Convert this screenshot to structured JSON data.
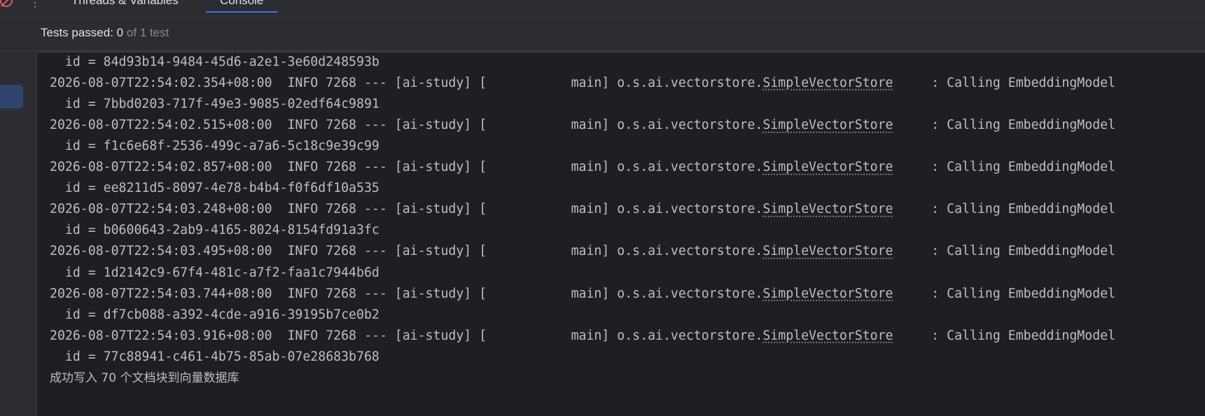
{
  "tabs": [
    {
      "label": "Threads & Variables",
      "active": false
    },
    {
      "label": "Console",
      "active": true
    }
  ],
  "status": {
    "label": "Tests passed: ",
    "passed": "0",
    "of_text": " of 1 test"
  },
  "console": {
    "lines": [
      {
        "type": "id",
        "text": "  id = 84d93b14-9484-45d6-a2e1-3e60d248593b"
      },
      {
        "type": "log",
        "prefix": "2026-08-07T22:54:02.354+08:00  INFO 7268 --- [ai-study] [           main] o.s.ai.vectorstore.",
        "link": "SimpleVectorStore",
        "suffix": "     : Calling EmbeddingModel"
      },
      {
        "type": "id",
        "text": "  id = 7bbd0203-717f-49e3-9085-02edf64c9891"
      },
      {
        "type": "log",
        "prefix": "2026-08-07T22:54:02.515+08:00  INFO 7268 --- [ai-study] [           main] o.s.ai.vectorstore.",
        "link": "SimpleVectorStore",
        "suffix": "     : Calling EmbeddingModel"
      },
      {
        "type": "id",
        "text": "  id = f1c6e68f-2536-499c-a7a6-5c18c9e39c99"
      },
      {
        "type": "log",
        "prefix": "2026-08-07T22:54:02.857+08:00  INFO 7268 --- [ai-study] [           main] o.s.ai.vectorstore.",
        "link": "SimpleVectorStore",
        "suffix": "     : Calling EmbeddingModel"
      },
      {
        "type": "id",
        "text": "  id = ee8211d5-8097-4e78-b4b4-f0f6df10a535"
      },
      {
        "type": "log",
        "prefix": "2026-08-07T22:54:03.248+08:00  INFO 7268 --- [ai-study] [           main] o.s.ai.vectorstore.",
        "link": "SimpleVectorStore",
        "suffix": "     : Calling EmbeddingModel"
      },
      {
        "type": "id",
        "text": "  id = b0600643-2ab9-4165-8024-8154fd91a3fc"
      },
      {
        "type": "log",
        "prefix": "2026-08-07T22:54:03.495+08:00  INFO 7268 --- [ai-study] [           main] o.s.ai.vectorstore.",
        "link": "SimpleVectorStore",
        "suffix": "     : Calling EmbeddingModel"
      },
      {
        "type": "id",
        "text": "  id = 1d2142c9-67f4-481c-a7f2-faa1c7944b6d"
      },
      {
        "type": "log",
        "prefix": "2026-08-07T22:54:03.744+08:00  INFO 7268 --- [ai-study] [           main] o.s.ai.vectorstore.",
        "link": "SimpleVectorStore",
        "suffix": "     : Calling EmbeddingModel"
      },
      {
        "type": "id",
        "text": "  id = df7cb088-a392-4cde-a916-39195b7ce0b2"
      },
      {
        "type": "log",
        "prefix": "2026-08-07T22:54:03.916+08:00  INFO 7268 --- [ai-study] [           main] o.s.ai.vectorstore.",
        "link": "SimpleVectorStore",
        "suffix": "     : Calling EmbeddingModel"
      },
      {
        "type": "id",
        "text": "  id = 77c88941-c461-4b75-85ab-07e28683b768"
      },
      {
        "type": "summary",
        "text": "成功写入 70 个文档块到向量数据库"
      }
    ]
  },
  "colors": {
    "background": "#1e1f22",
    "panel": "#2b2d30",
    "text": "#bcbec4",
    "accent": "#3574f0"
  },
  "icons": {
    "top_left": "stop-icon",
    "menu": "more-vertical-icon"
  }
}
